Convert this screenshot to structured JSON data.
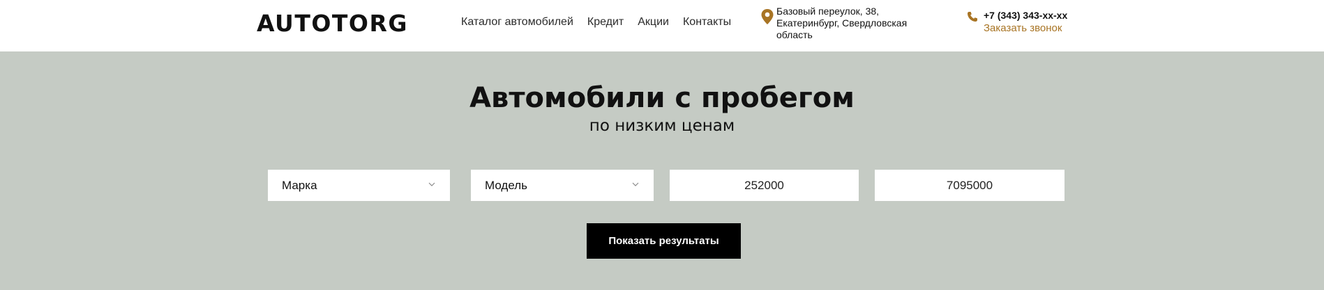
{
  "header": {
    "logo": "AUTOTORG",
    "nav": [
      "Каталог автомобилей",
      "Кредит",
      "Акции",
      "Контакты"
    ],
    "address": "Базовый переулок, 38, Екатеринбург, Свердловская область",
    "phone": "+7 (343) 343-xx-xx",
    "callback": "Заказать звонок",
    "accent_color": "#a87424"
  },
  "hero": {
    "title": "Автомобили с пробегом",
    "subtitle": "по низким ценам",
    "background": "#c5cbc4"
  },
  "filters": {
    "brand": "Марка",
    "model": "Модель",
    "price_from": "252000",
    "price_to": "7095000",
    "submit": "Показать результаты"
  },
  "icons": {
    "pin": "map-pin-icon",
    "phone": "phone-icon",
    "chevron": "chevron-down-icon"
  }
}
